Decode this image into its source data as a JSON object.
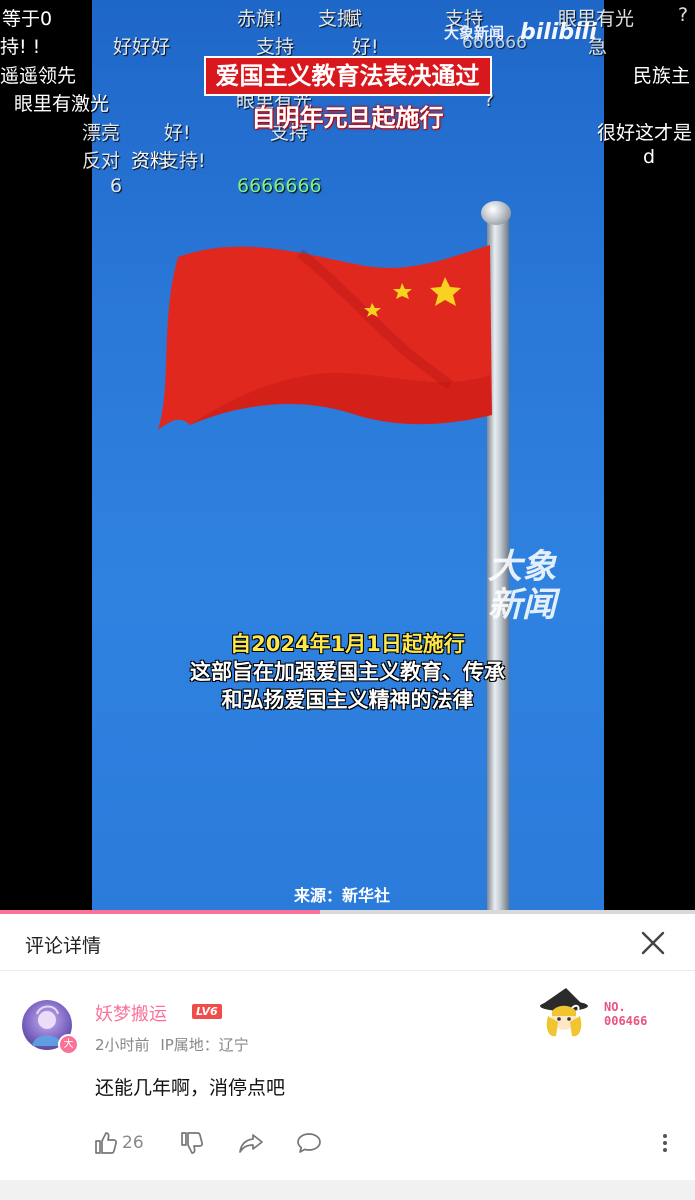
{
  "video": {
    "headline_line1": "爱国主义教育法表决通过",
    "headline_line2": "自明年元旦起施行",
    "watermark_top": "大象新闻",
    "bili_logo": "bilibili",
    "logo_right_line1": "大象",
    "logo_right_line2": "新闻",
    "caption_date": "自2024年1月1日起施行",
    "caption_line2": "这部旨在加强爱国主义教育、传承",
    "caption_line3": "和弘扬爱国主义精神的法律",
    "source": "来源：新华社",
    "progress_fraction": 0.46,
    "danmaku": [
      {
        "text": "等于0"
      },
      {
        "text": "赤旗!"
      },
      {
        "text": "支持"
      },
      {
        "text": "赋"
      },
      {
        "text": "支持"
      },
      {
        "text": "眼里有光"
      },
      {
        "text": "?"
      },
      {
        "text": "持!  !"
      },
      {
        "text": "好好好"
      },
      {
        "text": "支持"
      },
      {
        "text": "好!"
      },
      {
        "text": "666666"
      },
      {
        "text": "急"
      },
      {
        "text": "遥遥领先"
      },
      {
        "text": "民族主"
      },
      {
        "text": "眼里有激光"
      },
      {
        "text": "眼里有光"
      },
      {
        "text": "?"
      },
      {
        "text": "漂亮"
      },
      {
        "text": "好!"
      },
      {
        "text": "支持"
      },
      {
        "text": "很好这才是"
      },
      {
        "text": "反对"
      },
      {
        "text": "资料"
      },
      {
        "text": "支持!"
      },
      {
        "text": "d"
      },
      {
        "text": "6"
      },
      {
        "text": "6666666"
      }
    ]
  },
  "panel": {
    "title": "评论详情",
    "comment": {
      "username": "妖梦搬运",
      "level": "LV6",
      "avatar_badge": "大",
      "time": "2小时前",
      "ip_label": "IP属地：辽宁",
      "text": "还能几年啊，消停点吧",
      "fan_badge_label": "NO.",
      "fan_badge_number": "006466",
      "likes": "26"
    },
    "icons": {
      "close": "close-icon",
      "like": "thumbs-up-icon",
      "dislike": "thumbs-down-icon",
      "share": "share-icon",
      "reply": "comment-icon",
      "more": "more-vertical-icon"
    },
    "accent_color": "#fb7299"
  }
}
